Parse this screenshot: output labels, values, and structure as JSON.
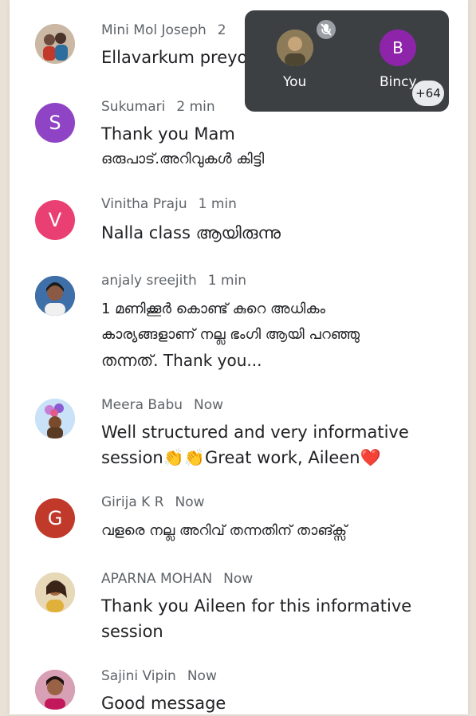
{
  "messages": [
    {
      "sender": "Mini Mol Joseph",
      "time": "2",
      "text": [
        "Ellavarkum preyoj"
      ]
    },
    {
      "sender": "Sukumari",
      "time": "2 min",
      "initial": "S",
      "color": "#8e44c4",
      "text": [
        "Thank you Mam",
        "ഒരുപാട്.അറിവുകൾ കിട്ടി"
      ]
    },
    {
      "sender": "Vinitha Praju",
      "time": "1 min",
      "initial": "V",
      "color": "#ea3f72",
      "text": [
        "Nalla class ആയിരുന്നു"
      ]
    },
    {
      "sender": "anjaly sreejith",
      "time": "1 min",
      "text": [
        "1 മണിക്കൂർ കൊണ്ട് കുറെ അധികം",
        "കാര്യങ്ങളാണ് നല്ല ഭംഗി ആയി പറഞ്ഞു",
        "തന്നത്. Thank you..."
      ]
    },
    {
      "sender": "Meera Babu",
      "time": "Now",
      "text": [
        "Well structured and very informative",
        "session👏👏Great work, Aileen❤️"
      ]
    },
    {
      "sender": "Girija K R",
      "time": "Now",
      "initial": "G",
      "color": "#c0392b",
      "text": [
        "വളരെ നല്ല അറിവ് തന്നതിന് താങ്ക്സ്"
      ]
    },
    {
      "sender": "APARNA MOHAN",
      "time": "Now",
      "text": [
        "Thank you Aileen for this informative",
        "session"
      ]
    },
    {
      "sender": "Sajini Vipin",
      "time": "Now",
      "text": [
        "Good message"
      ]
    }
  ],
  "overlay": {
    "you_label": "You",
    "other_label": "Bincy",
    "other_initial": "B",
    "other_color": "#8e24aa",
    "extra_count": "+64",
    "mic_icon": "mic-off-icon"
  }
}
